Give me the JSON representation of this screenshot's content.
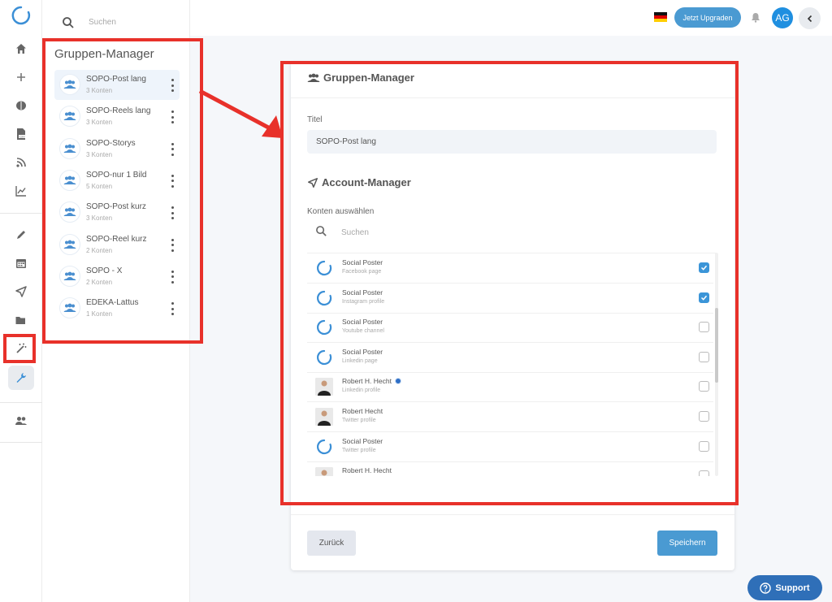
{
  "search": {
    "placeholder": "Suchen"
  },
  "panel": {
    "title": "Gruppen-Manager",
    "groups": [
      {
        "name": "SOPO-Post lang",
        "count": "3 Konten"
      },
      {
        "name": "SOPO-Reels lang",
        "count": "3 Konten"
      },
      {
        "name": "SOPO-Storys",
        "count": "3 Konten"
      },
      {
        "name": "SOPO-nur 1 Bild",
        "count": "5 Konten"
      },
      {
        "name": "SOPO-Post kurz",
        "count": "3 Konten"
      },
      {
        "name": "SOPO-Reel kurz",
        "count": "2 Konten"
      },
      {
        "name": "SOPO - X",
        "count": "2 Konten"
      },
      {
        "name": "EDEKA-Lattus",
        "count": "1 Konten"
      }
    ]
  },
  "topbar": {
    "upgrade_label": "Jetzt Upgraden",
    "avatar_initials": "AG"
  },
  "card": {
    "title": "Gruppen-Manager",
    "title_label": "Titel",
    "title_value": "SOPO-Post lang",
    "account_section": "Account-Manager",
    "select_label": "Konten auswählen",
    "search_placeholder": "Suchen",
    "accounts": [
      {
        "name": "Social Poster",
        "type": "Facebook page",
        "checked": true
      },
      {
        "name": "Social Poster",
        "type": "Instagram profile",
        "checked": true
      },
      {
        "name": "Social Poster",
        "type": "Youtube channel",
        "checked": false
      },
      {
        "name": "Social Poster",
        "type": "Linkedin page",
        "checked": false
      },
      {
        "name": "Robert H. Hecht",
        "type": "Linkedin profile",
        "checked": false
      },
      {
        "name": "Robert Hecht",
        "type": "Twitter profile",
        "checked": false
      },
      {
        "name": "Social Poster",
        "type": "Twitter profile",
        "checked": false
      },
      {
        "name": "Robert H. Hecht",
        "type": "",
        "checked": false
      }
    ],
    "back_label": "Zurück",
    "save_label": "Speichern"
  },
  "support_label": "Support",
  "colors": {
    "accent": "#4a9ad2",
    "annotation": "#e8312a",
    "support": "#2f6fb8"
  }
}
